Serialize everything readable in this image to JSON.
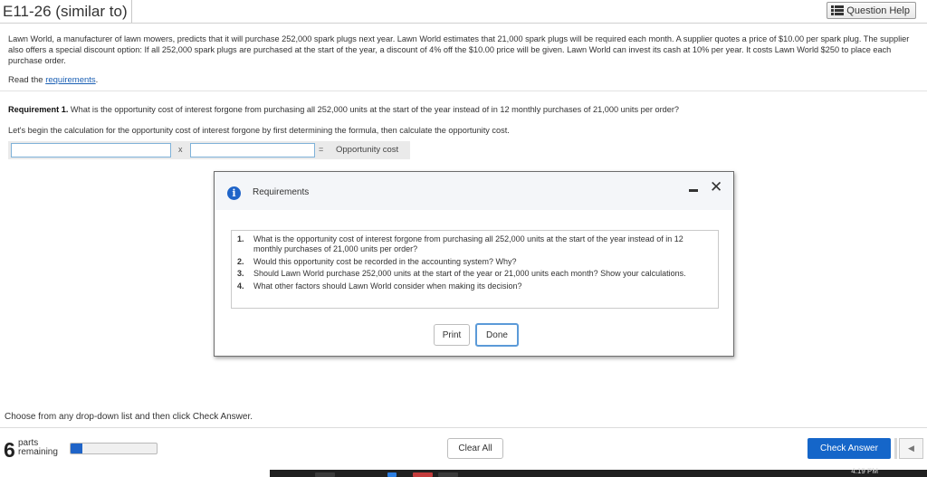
{
  "header": {
    "title": "E11-26 (similar to)",
    "help_label": "Question Help"
  },
  "problem": {
    "text": "Lawn World, a manufacturer of lawn mowers, predicts that it will purchase 252,000 spark plugs next year. Lawn World estimates that 21,000 spark plugs will be required each month. A supplier quotes a price of $10.00 per spark plug. The supplier also offers a special discount option: If all 252,000 spark plugs are purchased at the start of the year, a discount of 4% off the $10.00 price will be given. Lawn World can invest its cash at 10% per year. It costs Lawn World $250 to place each purchase order.",
    "read_prefix": "Read the ",
    "read_link": "requirements",
    "read_suffix": "."
  },
  "requirement1": {
    "label": "Requirement 1.",
    "question": " What is the opportunity cost of interest forgone from purchasing all 252,000 units at the start of the year instead of in 12 monthly purchases of 21,000 units per order?",
    "instruction": "Let's begin the calculation for the opportunity cost of interest forgone by first determining the formula, then calculate the opportunity cost."
  },
  "formula": {
    "times": "x",
    "equals": "=",
    "result_label": "Opportunity cost"
  },
  "modal": {
    "title": "Requirements",
    "items": [
      {
        "num": "1.",
        "text": "What is the opportunity cost of interest forgone from purchasing all 252,000 units at the start of the year instead of in 12 monthly purchases of 21,000 units per order?"
      },
      {
        "num": "2.",
        "text": "Would this opportunity cost be recorded in the accounting system? Why?"
      },
      {
        "num": "3.",
        "text": "Should Lawn World purchase 252,000 units at the start of the year or 21,000 units each month? Show your calculations."
      },
      {
        "num": "4.",
        "text": "What other factors should Lawn World consider when making its decision?"
      }
    ],
    "print_label": "Print",
    "done_label": "Done"
  },
  "footer": {
    "choose_text": "Choose from any drop-down list and then click Check Answer.",
    "parts_count": "6",
    "parts_line1": "parts",
    "parts_line2": "remaining",
    "progress_fraction": 0.14,
    "clear_label": "Clear All",
    "check_label": "Check Answer",
    "prev_glyph": "◀"
  },
  "taskbar": {
    "time": "4:19 PM"
  },
  "colors": {
    "accent": "#1566c9",
    "link": "#1a5fb4",
    "input_border": "#7fb2d9"
  }
}
